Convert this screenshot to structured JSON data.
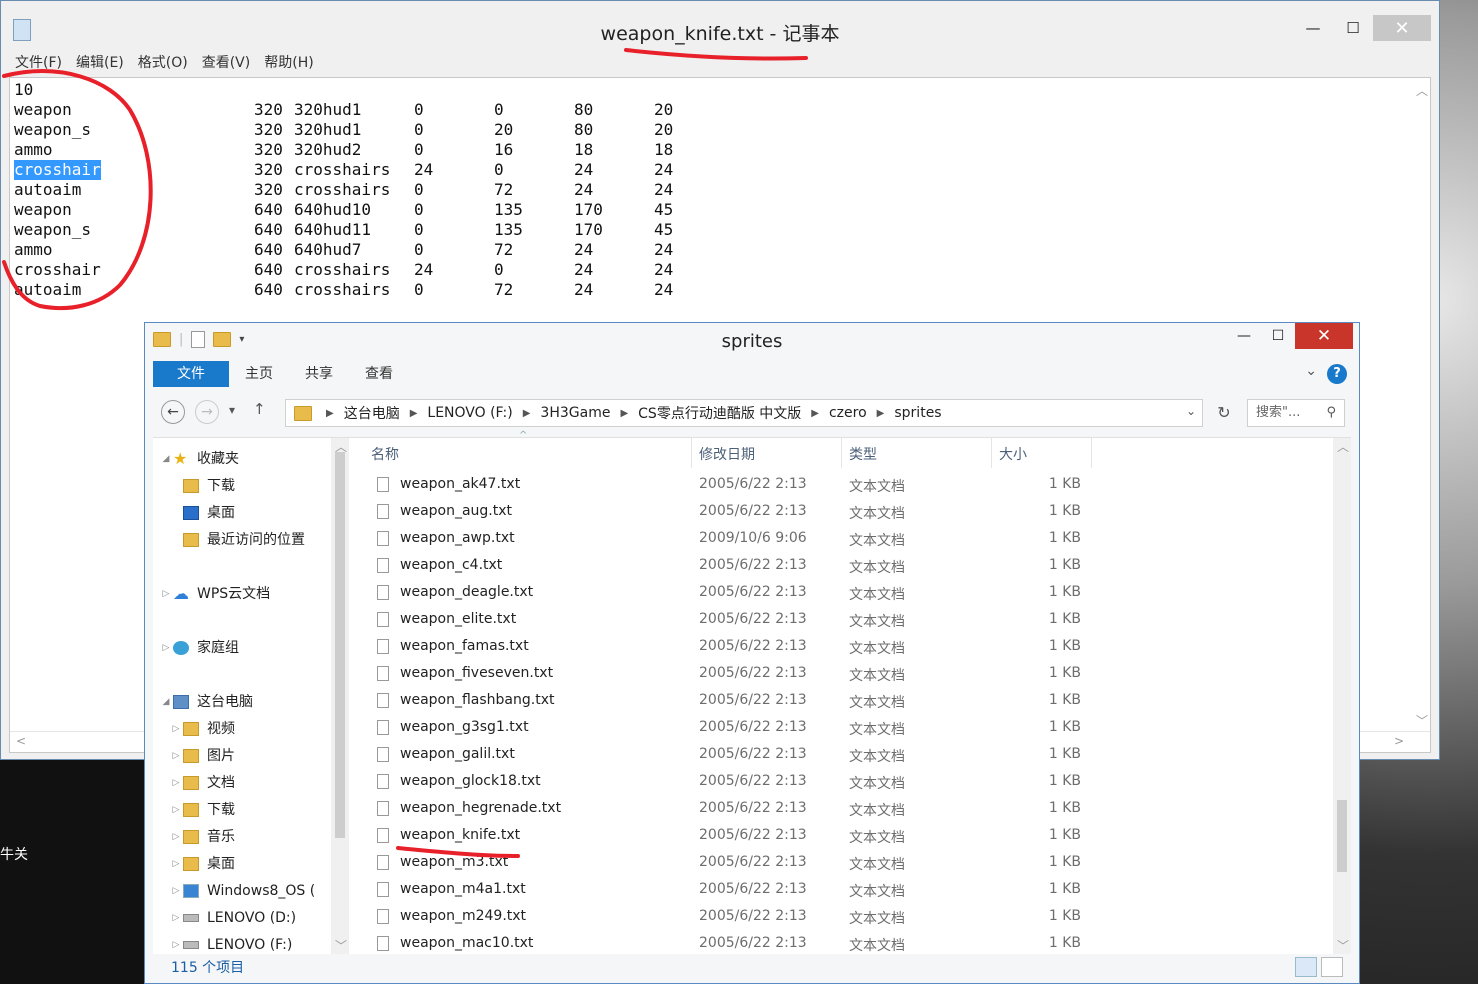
{
  "notepad": {
    "title": "weapon_knife.txt - 记事本",
    "menu": [
      "文件(F)",
      "编辑(E)",
      "格式(O)",
      "查看(V)",
      "帮助(H)"
    ],
    "window_buttons": {
      "minimize": "—",
      "maximize": "☐",
      "close": "✕"
    },
    "first_line": "10",
    "rows": [
      {
        "name": "weapon",
        "res": "320",
        "sprite": "320hud1",
        "x": "0",
        "y": "0",
        "w": "80",
        "h": "20"
      },
      {
        "name": "weapon_s",
        "res": "320",
        "sprite": "320hud1",
        "x": "0",
        "y": "20",
        "w": "80",
        "h": "20"
      },
      {
        "name": "ammo",
        "res": "320",
        "sprite": "320hud2",
        "x": "0",
        "y": "16",
        "w": "18",
        "h": "18"
      },
      {
        "name": "crosshair",
        "res": "320",
        "sprite": "crosshairs",
        "x": "24",
        "y": "0",
        "w": "24",
        "h": "24"
      },
      {
        "name": "autoaim",
        "res": "320",
        "sprite": "crosshairs",
        "x": "0",
        "y": "72",
        "w": "24",
        "h": "24"
      },
      {
        "name": "weapon",
        "res": "640",
        "sprite": "640hud10",
        "x": "0",
        "y": "135",
        "w": "170",
        "h": "45"
      },
      {
        "name": "weapon_s",
        "res": "640",
        "sprite": "640hud11",
        "x": "0",
        "y": "135",
        "w": "170",
        "h": "45"
      },
      {
        "name": "ammo",
        "res": "640",
        "sprite": "640hud7",
        "x": "0",
        "y": "72",
        "w": "24",
        "h": "24"
      },
      {
        "name": "crosshair",
        "res": "640",
        "sprite": "crosshairs",
        "x": "24",
        "y": "0",
        "w": "24",
        "h": "24"
      },
      {
        "name": "autoaim",
        "res": "640",
        "sprite": "crosshairs",
        "x": "0",
        "y": "72",
        "w": "24",
        "h": "24"
      }
    ],
    "selected_text": "crosshair"
  },
  "explorer": {
    "title": "sprites",
    "window_buttons": {
      "minimize": "—",
      "maximize": "☐",
      "close": "✕"
    },
    "ribbon_tabs": [
      "文件",
      "主页",
      "共享",
      "查看"
    ],
    "help": "?",
    "address": [
      "这台电脑",
      "LENOVO (F:)",
      "3H3Game",
      "CS零点行动迪酷版 中文版",
      "czero",
      "sprites"
    ],
    "search_placeholder": "搜索\"...",
    "nav": [
      {
        "label": "收藏夹",
        "icon": "star-icon"
      },
      {
        "label": "下载",
        "icon": "folder-download-icon"
      },
      {
        "label": "桌面",
        "icon": "desktop-icon"
      },
      {
        "label": "最近访问的位置",
        "icon": "recent-places-icon"
      },
      {
        "label": "WPS云文档",
        "icon": "cloud-icon"
      },
      {
        "label": "家庭组",
        "icon": "homegroup-icon"
      },
      {
        "label": "这台电脑",
        "icon": "computer-icon"
      },
      {
        "label": "视频",
        "icon": "folder-video-icon"
      },
      {
        "label": "图片",
        "icon": "folder-pictures-icon"
      },
      {
        "label": "文档",
        "icon": "folder-documents-icon"
      },
      {
        "label": "下载",
        "icon": "folder-download-icon"
      },
      {
        "label": "音乐",
        "icon": "folder-music-icon"
      },
      {
        "label": "桌面",
        "icon": "folder-desktop-icon"
      },
      {
        "label": "Windows8_OS (",
        "icon": "windows-drive-icon"
      },
      {
        "label": "LENOVO (D:)",
        "icon": "drive-icon"
      },
      {
        "label": "LENOVO (F:)",
        "icon": "drive-icon"
      }
    ],
    "columns": {
      "name": "名称",
      "date": "修改日期",
      "type": "类型",
      "size": "大小"
    },
    "files": [
      {
        "name": "weapon_ak47.txt",
        "date": "2005/6/22 2:13",
        "type": "文本文档",
        "size": "1 KB"
      },
      {
        "name": "weapon_aug.txt",
        "date": "2005/6/22 2:13",
        "type": "文本文档",
        "size": "1 KB"
      },
      {
        "name": "weapon_awp.txt",
        "date": "2009/10/6 9:06",
        "type": "文本文档",
        "size": "1 KB"
      },
      {
        "name": "weapon_c4.txt",
        "date": "2005/6/22 2:13",
        "type": "文本文档",
        "size": "1 KB"
      },
      {
        "name": "weapon_deagle.txt",
        "date": "2005/6/22 2:13",
        "type": "文本文档",
        "size": "1 KB"
      },
      {
        "name": "weapon_elite.txt",
        "date": "2005/6/22 2:13",
        "type": "文本文档",
        "size": "1 KB"
      },
      {
        "name": "weapon_famas.txt",
        "date": "2005/6/22 2:13",
        "type": "文本文档",
        "size": "1 KB"
      },
      {
        "name": "weapon_fiveseven.txt",
        "date": "2005/6/22 2:13",
        "type": "文本文档",
        "size": "1 KB"
      },
      {
        "name": "weapon_flashbang.txt",
        "date": "2005/6/22 2:13",
        "type": "文本文档",
        "size": "1 KB"
      },
      {
        "name": "weapon_g3sg1.txt",
        "date": "2005/6/22 2:13",
        "type": "文本文档",
        "size": "1 KB"
      },
      {
        "name": "weapon_galil.txt",
        "date": "2005/6/22 2:13",
        "type": "文本文档",
        "size": "1 KB"
      },
      {
        "name": "weapon_glock18.txt",
        "date": "2005/6/22 2:13",
        "type": "文本文档",
        "size": "1 KB"
      },
      {
        "name": "weapon_hegrenade.txt",
        "date": "2005/6/22 2:13",
        "type": "文本文档",
        "size": "1 KB"
      },
      {
        "name": "weapon_knife.txt",
        "date": "2005/6/22 2:13",
        "type": "文本文档",
        "size": "1 KB"
      },
      {
        "name": "weapon_m3.txt",
        "date": "2005/6/22 2:13",
        "type": "文本文档",
        "size": "1 KB"
      },
      {
        "name": "weapon_m4a1.txt",
        "date": "2005/6/22 2:13",
        "type": "文本文档",
        "size": "1 KB"
      },
      {
        "name": "weapon_m249.txt",
        "date": "2005/6/22 2:13",
        "type": "文本文档",
        "size": "1 KB"
      },
      {
        "name": "weapon_mac10.txt",
        "date": "2005/6/22 2:13",
        "type": "文本文档",
        "size": "1 KB"
      }
    ],
    "status": "115 个项目"
  },
  "desktop": {
    "partial_label": "牛关"
  },
  "colors": {
    "annotation": "#e8202a",
    "selection": "#3399ff",
    "ribbon_file": "#1979ca",
    "close_button": "#c9352b"
  }
}
